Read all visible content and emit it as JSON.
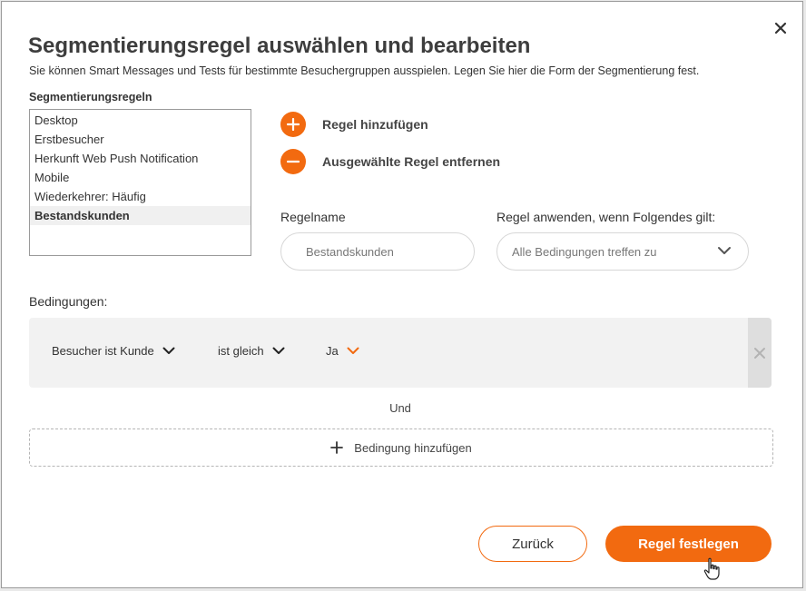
{
  "dialog": {
    "title": "Segmentierungsregel auswählen und bearbeiten",
    "subtitle": "Sie können Smart Messages und Tests für bestimmte Besuchergruppen ausspielen. Legen Sie hier die Form der Segmentierung fest.",
    "close_icon": "close-icon"
  },
  "rules": {
    "label": "Segmentierungsregeln",
    "items": [
      "Desktop",
      "Erstbesucher",
      "Herkunft Web Push Notification",
      "Mobile",
      "Wiederkehrer: Häufig",
      "Bestandskunden"
    ],
    "selected_index": 5
  },
  "actions": {
    "add_label": "Regel hinzufügen",
    "remove_label": "Ausgewählte Regel entfernen"
  },
  "form": {
    "name_label": "Regelname",
    "name_value": "Bestandskunden",
    "apply_label": "Regel anwenden, wenn Folgendes gilt:",
    "apply_value": "Alle Bedingungen treffen zu"
  },
  "conditions": {
    "label": "Bedingungen:",
    "items": [
      {
        "field": "Besucher ist Kunde",
        "operator": "ist gleich",
        "value": "Ja"
      }
    ],
    "connector": "Und",
    "add_label": "Bedingung hinzufügen"
  },
  "buttons": {
    "back": "Zurück",
    "submit": "Regel festlegen"
  },
  "colors": {
    "accent": "#f26a10",
    "selected_row": "#f0f0f0",
    "condition_bg": "#f2f2f2"
  }
}
